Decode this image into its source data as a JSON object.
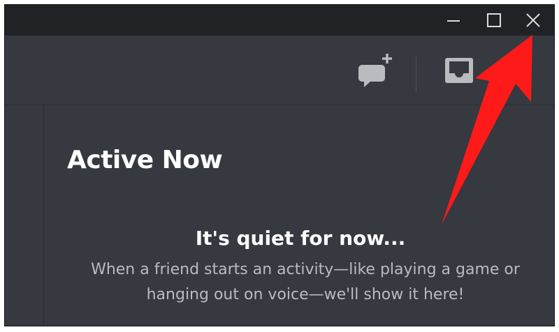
{
  "window_controls": {
    "minimize": "minimize-icon",
    "maximize": "maximize-icon",
    "close": "close-icon"
  },
  "header": {
    "icons": [
      "new-group-dm-icon",
      "inbox-icon"
    ]
  },
  "active_now": {
    "title": "Active Now",
    "empty_title": "It's quiet for now...",
    "empty_text": "When a friend starts an activity—like playing a game or hanging out on voice—we'll show it here!"
  },
  "annotation": {
    "arrow_color": "#ff1a1a",
    "points_to": "close-button"
  },
  "colors": {
    "titlebar": "#202225",
    "background": "#36393f",
    "text_primary": "#ffffff",
    "text_muted": "#b9bbbe",
    "icon": "#b9bbbe"
  }
}
